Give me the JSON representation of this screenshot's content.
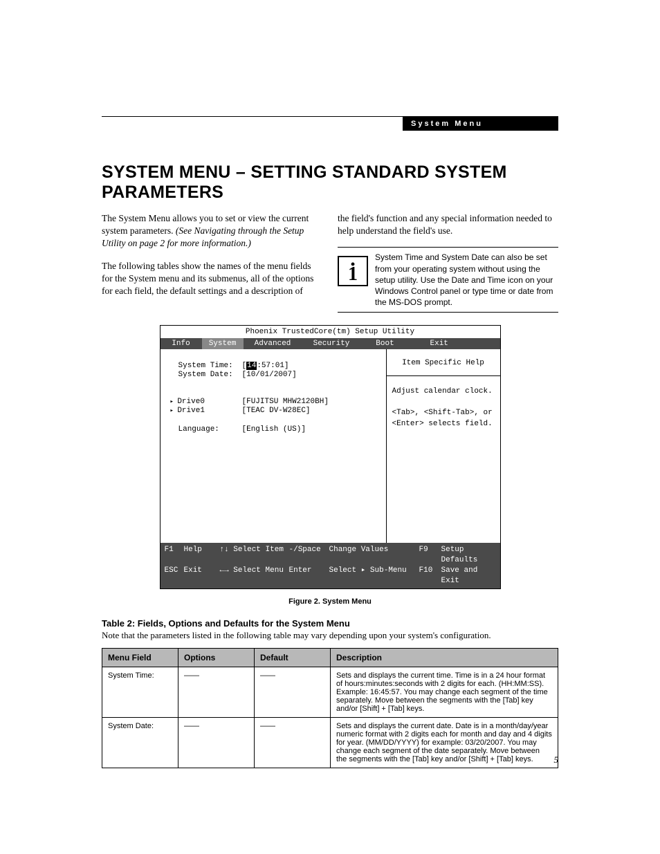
{
  "header": {
    "label": "System Menu"
  },
  "title": "SYSTEM MENU – SETTING STANDARD SYSTEM PARAMETERS",
  "para1a": "The System Menu allows you to set or view the current system parameters. ",
  "para1b": "(See Navigating through the Setup Utility on page 2 for more information.)",
  "para2": "The following tables show the names of the menu fields for the System menu and its submenus, all of the options for each field, the default settings and a description of",
  "para3": "the field's function and any special information needed to help understand the field's use.",
  "infobox": "System Time and System Date can also be set from your operating system without using the setup utility. Use the Date and Time icon on your Windows Control panel or type time or date from the MS-DOS prompt.",
  "bios": {
    "title": "Phoenix TrustedCore(tm) Setup Utility",
    "tabs": {
      "info": "Info",
      "system": "System",
      "advanced": "Advanced",
      "security": "Security",
      "boot": "Boot",
      "exit": "Exit"
    },
    "help_header": "Item Specific Help",
    "help_body1": "Adjust calendar clock.",
    "help_body2": "<Tab>, <Shift-Tab>, or <Enter> selects field.",
    "rows": {
      "time_label": "System Time:",
      "time_hl": "14",
      "time_rest": ":57:01]",
      "date_label": "System Date:",
      "date_val": "[10/01/2007]",
      "drive0_label": "Drive0",
      "drive0_val": "[FUJITSU MHW2120BH]",
      "drive1_label": "Drive1",
      "drive1_val": "[TEAC DV-W28EC]",
      "lang_label": "Language:",
      "lang_val": "[English (US)]"
    },
    "footer": {
      "r1": {
        "c1": "F1",
        "c2": "Help",
        "c3": "↑↓ Select Item",
        "c4": "-/Space",
        "c5": "Change Values",
        "c6": "F9",
        "c7": "Setup Defaults"
      },
      "r2": {
        "c1": "ESC",
        "c2": "Exit",
        "c3": "←→ Select Menu",
        "c4": "Enter",
        "c5": "Select ▸ Sub-Menu",
        "c6": "F10",
        "c7": "Save and Exit"
      }
    }
  },
  "figure_caption": "Figure 2.   System Menu",
  "table_title": "Table 2: Fields, Options and Defaults for the System Menu",
  "table_note": "Note that the parameters listed in the following table may vary depending upon your system's configuration.",
  "table": {
    "headers": {
      "field": "Menu Field",
      "options": "Options",
      "default": "Default",
      "desc": "Description"
    },
    "rows": [
      {
        "field": "System Time:",
        "options": "——",
        "default": "——",
        "desc": "Sets and displays the current time. Time is in a 24 hour format of hours:minutes:seconds with 2 digits for each. (HH:MM:SS). Example: 16:45:57. You may change each segment of the time separately. Move between the segments with the [Tab] key and/or [Shift] + [Tab] keys."
      },
      {
        "field": "System Date:",
        "options": "——",
        "default": "——",
        "desc": "Sets and displays the current date. Date is in a month/day/year numeric format with 2 digits each for month and day and 4 digits for year. (MM/DD/YYYY) for example: 03/20/2007. You may change each segment of the date separately. Move between the segments with the [Tab] key and/or [Shift] + [Tab] keys."
      }
    ]
  },
  "page_number": "5"
}
